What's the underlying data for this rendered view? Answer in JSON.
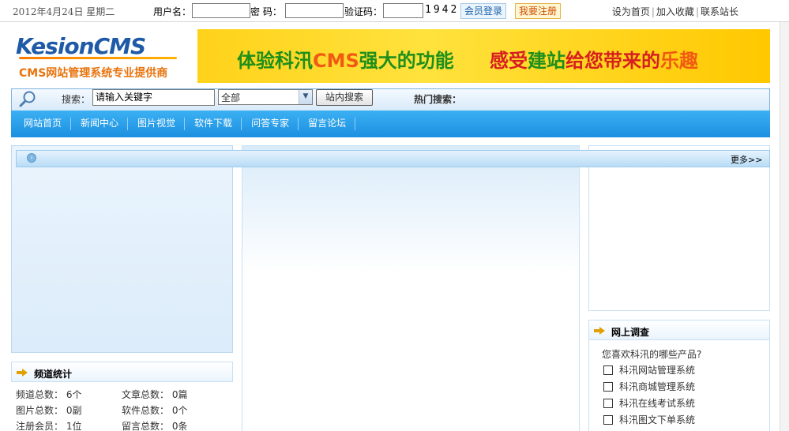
{
  "topbar": {
    "date": "2012年4月24日 星期二",
    "username_label": "用户名：",
    "password_label": "密  码：",
    "captcha_label": "验证码：",
    "captcha_code": "1942",
    "login_button": "会员登录",
    "register_button": "我要注册",
    "links": [
      "设为首页",
      "加入收藏",
      "联系站长"
    ]
  },
  "logo": {
    "wordmark": "KesionCMS",
    "tagline": "CMS网站管理系统专业提供商"
  },
  "banner": {
    "left_text_a": "体验科汛",
    "left_text_b": "CMS",
    "left_text_c": "强大的功能",
    "right_text_a": "感受",
    "right_text_b": "建站",
    "right_text_c": "给您带来的",
    "right_text_d": "乐趣"
  },
  "search": {
    "label": "搜索：",
    "input_value": "请输入关键字",
    "select_value": "全部",
    "button": "站内搜索",
    "hot_label": "热门搜索："
  },
  "nav": {
    "items": [
      "网站首页",
      "新闻中心",
      "图片视觉",
      "软件下载",
      "问答专家",
      "留言论坛"
    ]
  },
  "content": {
    "more_link": "更多>>"
  },
  "stats": {
    "title": "频道统计",
    "rows": [
      [
        {
          "label": "频道总数：",
          "value": "6个"
        },
        {
          "label": "文章总数：",
          "value": "0篇"
        }
      ],
      [
        {
          "label": "图片总数：",
          "value": "0副"
        },
        {
          "label": "软件总数：",
          "value": "0个"
        }
      ],
      [
        {
          "label": "注册会员：",
          "value": "1位"
        },
        {
          "label": "留言总数：",
          "value": "0条"
        }
      ]
    ]
  },
  "survey": {
    "title": "网上调查",
    "question": "您喜欢科汛的哪些产品?",
    "options": [
      "科汛网站管理系统",
      "科汛商城管理系统",
      "科汛在线考试系统",
      "科汛图文下单系统"
    ]
  },
  "colors": {
    "nav_blue": "#1c8fe0",
    "link_orange": "#d14c00",
    "banner_yellow": "#ffd21a",
    "banner_green": "#1e8f1a"
  }
}
